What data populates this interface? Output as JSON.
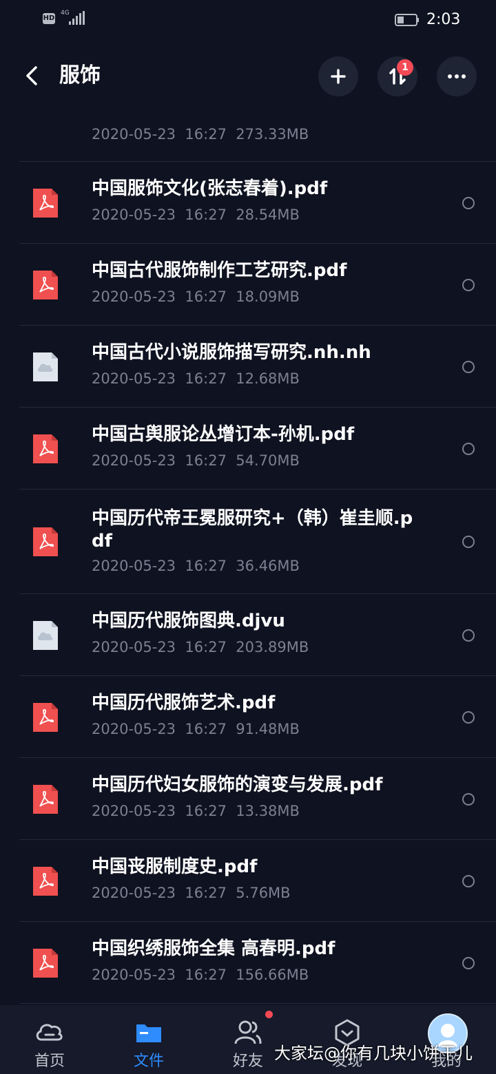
{
  "status_bar": {
    "hd": "HD",
    "network": "4G",
    "time": "2:03"
  },
  "header": {
    "title": "服饰",
    "transfer_badge": "1",
    "icons": [
      "back-icon",
      "plus-icon",
      "transfer-icon",
      "more-icon"
    ]
  },
  "partial_row": {
    "date": "2020-05-23",
    "time": "16:27",
    "size": "273.33MB"
  },
  "files": [
    {
      "name": "中国服饰文化(张志春着).pdf",
      "date": "2020-05-23",
      "time": "16:27",
      "size": "28.54MB",
      "type": "pdf"
    },
    {
      "name": "中国古代服饰制作工艺研究.pdf",
      "date": "2020-05-23",
      "time": "16:27",
      "size": "18.09MB",
      "type": "pdf"
    },
    {
      "name": "中国古代小说服饰描写研究.nh.nh",
      "date": "2020-05-23",
      "time": "16:27",
      "size": "12.68MB",
      "type": "other"
    },
    {
      "name": "中国古舆服论丛增订本-孙机.pdf",
      "date": "2020-05-23",
      "time": "16:27",
      "size": "54.70MB",
      "type": "pdf"
    },
    {
      "name": "中国历代帝王冕服研究+（韩）崔圭顺.pdf",
      "date": "2020-05-23",
      "time": "16:27",
      "size": "36.46MB",
      "type": "pdf"
    },
    {
      "name": "中国历代服饰图典.djvu",
      "date": "2020-05-23",
      "time": "16:27",
      "size": "203.89MB",
      "type": "other"
    },
    {
      "name": "中国历代服饰艺术.pdf",
      "date": "2020-05-23",
      "time": "16:27",
      "size": "91.48MB",
      "type": "pdf"
    },
    {
      "name": "中国历代妇女服饰的演变与发展.pdf",
      "date": "2020-05-23",
      "time": "16:27",
      "size": "13.38MB",
      "type": "pdf"
    },
    {
      "name": "中国丧服制度史.pdf",
      "date": "2020-05-23",
      "time": "16:27",
      "size": "5.76MB",
      "type": "pdf"
    },
    {
      "name": "中国织绣服饰全集 高春明.pdf",
      "date": "2020-05-23",
      "time": "16:27",
      "size": "156.66MB",
      "type": "pdf"
    }
  ],
  "bottom_nav": {
    "items": [
      {
        "label": "首页",
        "icon": "cloud-home-icon"
      },
      {
        "label": "文件",
        "icon": "folder-icon",
        "active": true
      },
      {
        "label": "好友",
        "icon": "friends-icon"
      },
      {
        "label": "发现",
        "icon": "discover-icon"
      },
      {
        "label": "我的",
        "icon": "avatar-icon"
      }
    ]
  },
  "watermark": "大家坛@你有几块小饼干儿",
  "colors": {
    "background": "#0f1220",
    "accent": "#2f8cff",
    "pdf_icon": "#f05050",
    "badge": "#f44a55"
  }
}
